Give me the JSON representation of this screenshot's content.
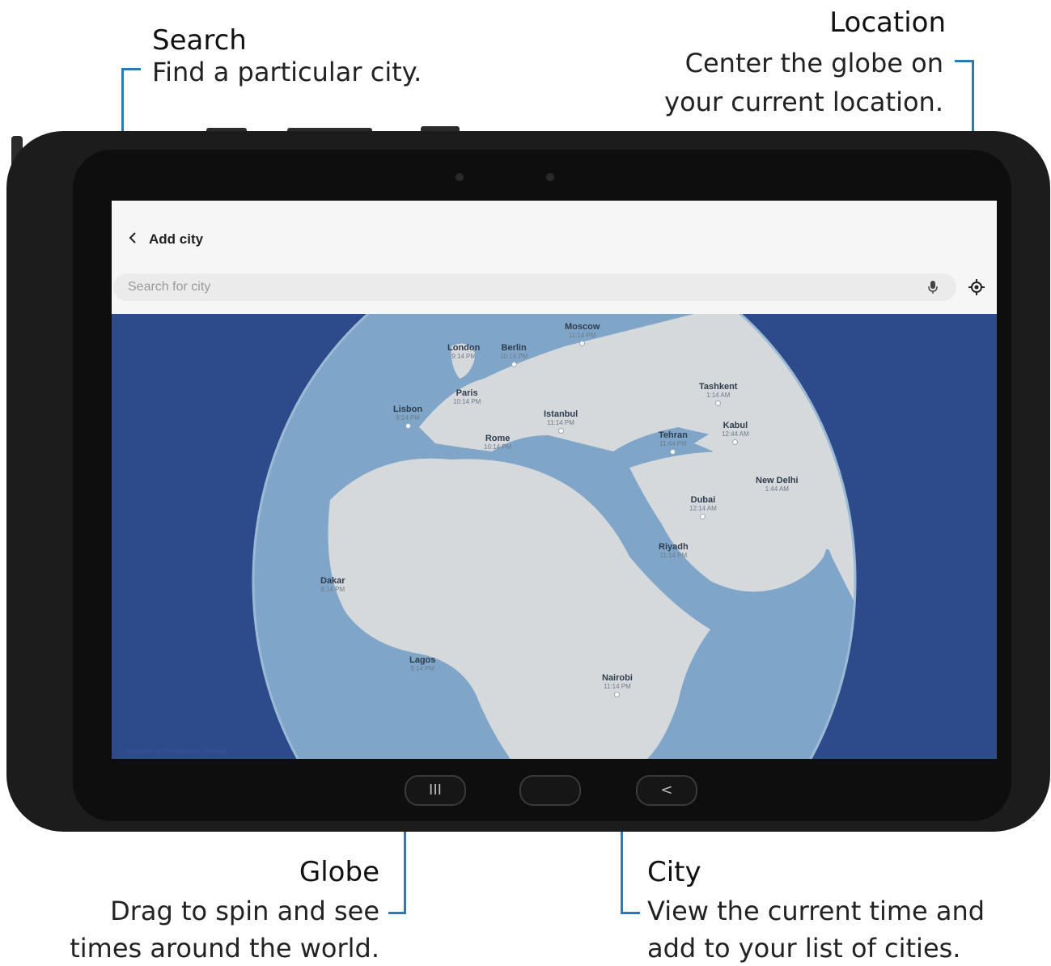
{
  "callouts": {
    "search": {
      "title": "Search",
      "desc": "Find a particular city."
    },
    "location": {
      "title": "Location",
      "desc_line1": "Center the globe on",
      "desc_line2": "your current location."
    },
    "globe": {
      "title": "Globe",
      "desc_line1": "Drag to spin and see",
      "desc_line2": "times around the world."
    },
    "city": {
      "title": "City",
      "desc_line1": "View the current time and",
      "desc_line2": "add to your list of cities."
    }
  },
  "app": {
    "back_icon": "chevron-left-icon",
    "title": "Add city",
    "search_placeholder": "Search for city",
    "mic_icon": "mic-icon",
    "location_icon": "my-location-icon",
    "credit": "powered by The Weather Channel"
  },
  "cities": [
    {
      "name": "Moscow",
      "time": "11:14 PM"
    },
    {
      "name": "London",
      "time": "9:14 PM"
    },
    {
      "name": "Berlin",
      "time": "10:14 PM"
    },
    {
      "name": "Paris",
      "time": "10:14 PM"
    },
    {
      "name": "Lisbon",
      "time": "9:14 PM"
    },
    {
      "name": "Istanbul",
      "time": "11:14 PM"
    },
    {
      "name": "Rome",
      "time": "10:14 PM"
    },
    {
      "name": "Tashkent",
      "time": "1:14 AM"
    },
    {
      "name": "Kabul",
      "time": "12:44 AM"
    },
    {
      "name": "Tehran",
      "time": "11:44 PM"
    },
    {
      "name": "New Delhi",
      "time": "1:44 AM"
    },
    {
      "name": "Dubai",
      "time": "12:14 AM"
    },
    {
      "name": "Riyadh",
      "time": "11:14 PM"
    },
    {
      "name": "Dakar",
      "time": "8:14 PM"
    },
    {
      "name": "Lagos",
      "time": "9:14 PM"
    },
    {
      "name": "Nairobi",
      "time": "11:14 PM"
    }
  ],
  "navbar": {
    "recents_icon": "recents-icon",
    "home_icon": "home-icon",
    "back_icon": "back-icon",
    "recents_glyph": "III",
    "back_glyph": "<"
  },
  "colors": {
    "ocean": "#2d4a8a",
    "globe_water": "#7fa6c9",
    "land": "#d6d9dc",
    "callout_line": "#2a7ab8"
  }
}
